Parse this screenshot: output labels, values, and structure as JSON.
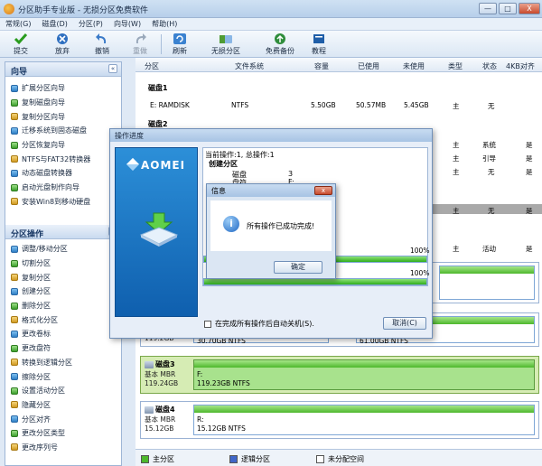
{
  "window": {
    "title": "分区助手专业版 - 无损分区免费软件",
    "min": "—",
    "max": "□",
    "close": "X"
  },
  "menu": [
    "常规(G)",
    "磁盘(D)",
    "分区(P)",
    "向导(W)",
    "帮助(H)"
  ],
  "toolbar": {
    "submit": "提交",
    "discard": "放弃",
    "undo": "撤销",
    "redo": "重做",
    "refresh": "刷新",
    "lossless": "无损分区",
    "backup": "免费备份",
    "tutorial": "教程"
  },
  "left": {
    "wizard_title": "向导",
    "wizard_items": [
      "扩展分区向导",
      "复制磁盘向导",
      "复制分区向导",
      "迁移系统到固态磁盘",
      "分区恢复向导",
      "NTFS与FAT32转换器",
      "动态磁盘转换器",
      "启动光盘制作向导",
      "安装Win8到移动硬盘"
    ],
    "ops_title": "分区操作",
    "ops_items": [
      "调整/移动分区",
      "切割分区",
      "复制分区",
      "创建分区",
      "删除分区",
      "格式化分区",
      "更改卷标",
      "更改盘符",
      "转换到逻辑分区",
      "擦除分区",
      "设置活动分区",
      "隐藏分区",
      "分区对齐",
      "更改分区类型",
      "更改序列号"
    ]
  },
  "columns": {
    "partition": "分区",
    "fs": "文件系统",
    "capacity": "容量",
    "used": "已使用",
    "unused": "未使用",
    "type": "类型",
    "status": "状态",
    "align": "4KB对齐"
  },
  "disk1": {
    "label": "磁盘1",
    "row": {
      "name": "E: RAMDISK",
      "fs": "NTFS",
      "capacity": "5.50GB",
      "used": "50.57MB",
      "unused": "5.45GB",
      "type": "主",
      "status": "无"
    }
  },
  "disk2": {
    "label": "磁盘2"
  },
  "rows_extra": [
    {
      "type": "主",
      "status": "系统",
      "align": "是"
    },
    {
      "type": "主",
      "status": "引导",
      "align": "是"
    },
    {
      "type": "主",
      "status": "无",
      "align": "是"
    }
  ],
  "selrow": {
    "type": "主",
    "status": "无",
    "align": "是"
  },
  "row_active": {
    "type": "主",
    "status": "活动",
    "align": "是"
  },
  "card_partial": {
    "size": "119.2GB",
    "p1": "30.70GB NTFS",
    "p2": "61.00GB NTFS"
  },
  "disk3": {
    "name": "磁盘3",
    "type": "基本 MBR",
    "size": "119.24GB",
    "part": "F:",
    "detail": "119.23GB NTFS"
  },
  "disk4": {
    "name": "磁盘4",
    "type": "基本 MBR",
    "size": "15.12GB",
    "part": "R:",
    "detail": "15.12GB NTFS"
  },
  "legend": {
    "primary": "主分区",
    "logical": "逻辑分区",
    "unalloc": "未分配空间"
  },
  "progress": {
    "title": "操作进度",
    "logo": "AOMEI",
    "current": "当前操作:1, 总操作:1",
    "op": "创建分区",
    "disk_label": "磁盘",
    "disk_val": "3",
    "letter_label": "盘符",
    "letter_val": "F:",
    "pct1": "100%",
    "pct2": "100%",
    "pct1_value": 100,
    "pct2_value": 100,
    "shutdown": "在完成所有操作后自动关机(S).",
    "cancel": "取消(C)"
  },
  "info": {
    "title": "信息",
    "message": "所有操作已成功完成!",
    "ok": "确定"
  }
}
